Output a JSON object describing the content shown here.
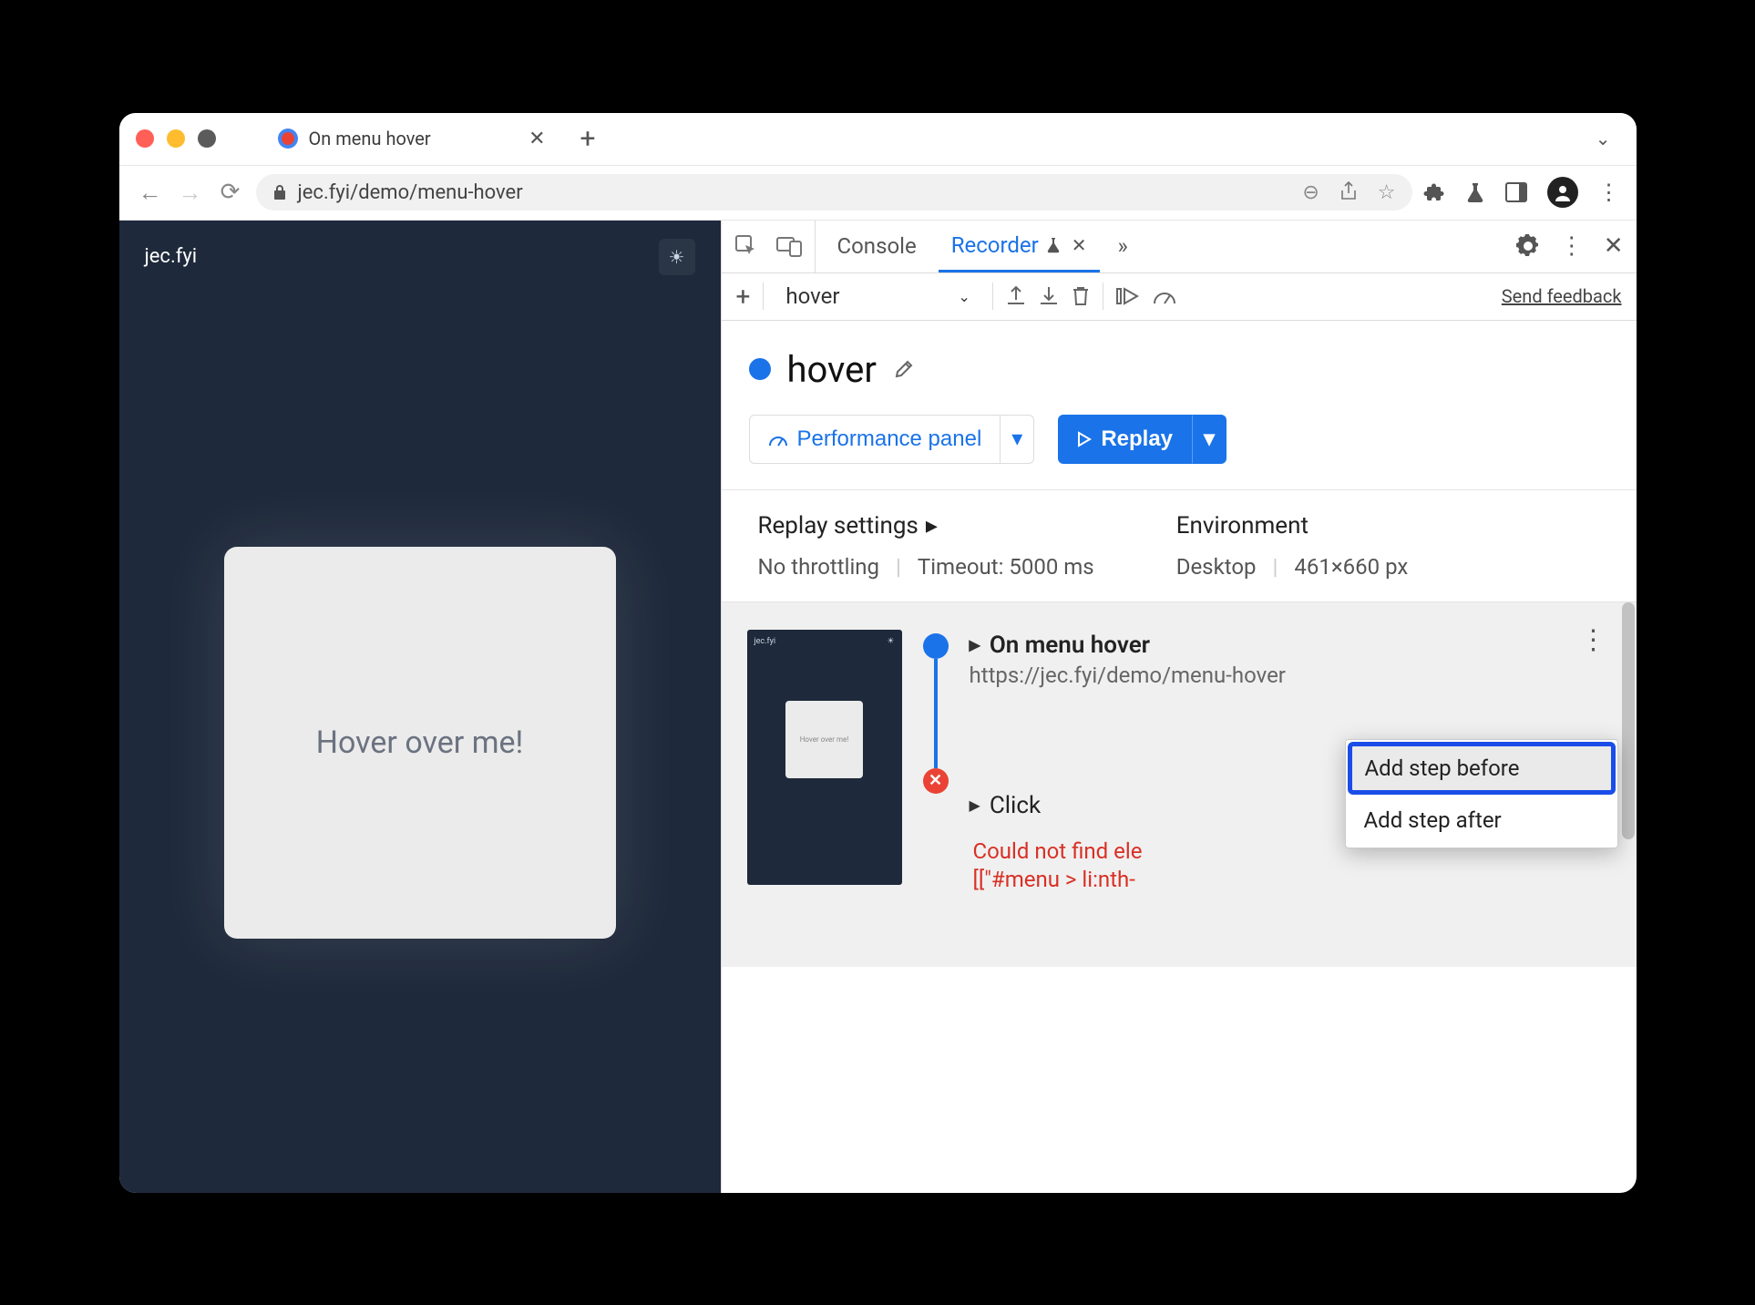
{
  "browser": {
    "tab_title": "On menu hover",
    "url": "jec.fyi/demo/menu-hover"
  },
  "page": {
    "site_name": "jec.fyi",
    "card_text": "Hover over me!"
  },
  "devtools": {
    "tabs": {
      "console": "Console",
      "recorder": "Recorder"
    },
    "recorder_select": "hover",
    "feedback": "Send feedback",
    "recording_name": "hover",
    "perf_button": "Performance panel",
    "replay_button": "Replay",
    "settings": {
      "replay_heading": "Replay settings",
      "throttling": "No throttling",
      "timeout": "Timeout: 5000 ms",
      "env_heading": "Environment",
      "device": "Desktop",
      "dimensions": "461×660 px"
    },
    "steps": {
      "s1_title": "On menu hover",
      "s1_url": "https://jec.fyi/demo/menu-hover",
      "s2_title": "Click",
      "error_line1": "Could not find ele",
      "error_line2": "[[\"#menu > li:nth-"
    },
    "menu": {
      "before": "Add step before",
      "after": "Add step after"
    },
    "thumb": {
      "site": "jec.fyi",
      "card": "Hover over me!"
    }
  }
}
